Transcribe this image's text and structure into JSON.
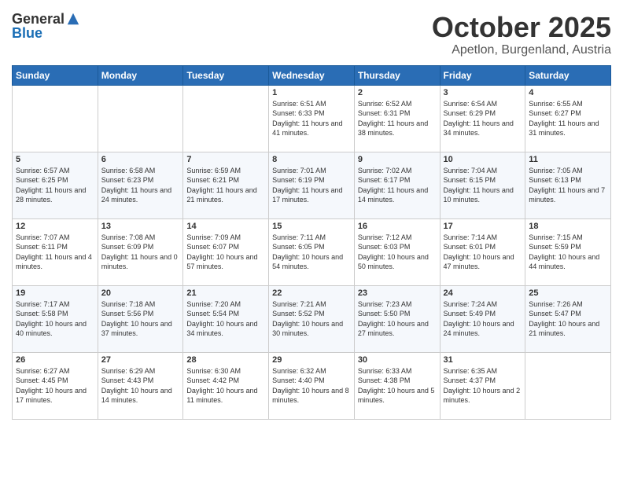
{
  "logo": {
    "general": "General",
    "blue": "Blue"
  },
  "header": {
    "month": "October 2025",
    "location": "Apetlon, Burgenland, Austria"
  },
  "days_of_week": [
    "Sunday",
    "Monday",
    "Tuesday",
    "Wednesday",
    "Thursday",
    "Friday",
    "Saturday"
  ],
  "weeks": [
    [
      {
        "day": "",
        "info": ""
      },
      {
        "day": "",
        "info": ""
      },
      {
        "day": "",
        "info": ""
      },
      {
        "day": "1",
        "info": "Sunrise: 6:51 AM\nSunset: 6:33 PM\nDaylight: 11 hours and 41 minutes."
      },
      {
        "day": "2",
        "info": "Sunrise: 6:52 AM\nSunset: 6:31 PM\nDaylight: 11 hours and 38 minutes."
      },
      {
        "day": "3",
        "info": "Sunrise: 6:54 AM\nSunset: 6:29 PM\nDaylight: 11 hours and 34 minutes."
      },
      {
        "day": "4",
        "info": "Sunrise: 6:55 AM\nSunset: 6:27 PM\nDaylight: 11 hours and 31 minutes."
      }
    ],
    [
      {
        "day": "5",
        "info": "Sunrise: 6:57 AM\nSunset: 6:25 PM\nDaylight: 11 hours and 28 minutes."
      },
      {
        "day": "6",
        "info": "Sunrise: 6:58 AM\nSunset: 6:23 PM\nDaylight: 11 hours and 24 minutes."
      },
      {
        "day": "7",
        "info": "Sunrise: 6:59 AM\nSunset: 6:21 PM\nDaylight: 11 hours and 21 minutes."
      },
      {
        "day": "8",
        "info": "Sunrise: 7:01 AM\nSunset: 6:19 PM\nDaylight: 11 hours and 17 minutes."
      },
      {
        "day": "9",
        "info": "Sunrise: 7:02 AM\nSunset: 6:17 PM\nDaylight: 11 hours and 14 minutes."
      },
      {
        "day": "10",
        "info": "Sunrise: 7:04 AM\nSunset: 6:15 PM\nDaylight: 11 hours and 10 minutes."
      },
      {
        "day": "11",
        "info": "Sunrise: 7:05 AM\nSunset: 6:13 PM\nDaylight: 11 hours and 7 minutes."
      }
    ],
    [
      {
        "day": "12",
        "info": "Sunrise: 7:07 AM\nSunset: 6:11 PM\nDaylight: 11 hours and 4 minutes."
      },
      {
        "day": "13",
        "info": "Sunrise: 7:08 AM\nSunset: 6:09 PM\nDaylight: 11 hours and 0 minutes."
      },
      {
        "day": "14",
        "info": "Sunrise: 7:09 AM\nSunset: 6:07 PM\nDaylight: 10 hours and 57 minutes."
      },
      {
        "day": "15",
        "info": "Sunrise: 7:11 AM\nSunset: 6:05 PM\nDaylight: 10 hours and 54 minutes."
      },
      {
        "day": "16",
        "info": "Sunrise: 7:12 AM\nSunset: 6:03 PM\nDaylight: 10 hours and 50 minutes."
      },
      {
        "day": "17",
        "info": "Sunrise: 7:14 AM\nSunset: 6:01 PM\nDaylight: 10 hours and 47 minutes."
      },
      {
        "day": "18",
        "info": "Sunrise: 7:15 AM\nSunset: 5:59 PM\nDaylight: 10 hours and 44 minutes."
      }
    ],
    [
      {
        "day": "19",
        "info": "Sunrise: 7:17 AM\nSunset: 5:58 PM\nDaylight: 10 hours and 40 minutes."
      },
      {
        "day": "20",
        "info": "Sunrise: 7:18 AM\nSunset: 5:56 PM\nDaylight: 10 hours and 37 minutes."
      },
      {
        "day": "21",
        "info": "Sunrise: 7:20 AM\nSunset: 5:54 PM\nDaylight: 10 hours and 34 minutes."
      },
      {
        "day": "22",
        "info": "Sunrise: 7:21 AM\nSunset: 5:52 PM\nDaylight: 10 hours and 30 minutes."
      },
      {
        "day": "23",
        "info": "Sunrise: 7:23 AM\nSunset: 5:50 PM\nDaylight: 10 hours and 27 minutes."
      },
      {
        "day": "24",
        "info": "Sunrise: 7:24 AM\nSunset: 5:49 PM\nDaylight: 10 hours and 24 minutes."
      },
      {
        "day": "25",
        "info": "Sunrise: 7:26 AM\nSunset: 5:47 PM\nDaylight: 10 hours and 21 minutes."
      }
    ],
    [
      {
        "day": "26",
        "info": "Sunrise: 6:27 AM\nSunset: 4:45 PM\nDaylight: 10 hours and 17 minutes."
      },
      {
        "day": "27",
        "info": "Sunrise: 6:29 AM\nSunset: 4:43 PM\nDaylight: 10 hours and 14 minutes."
      },
      {
        "day": "28",
        "info": "Sunrise: 6:30 AM\nSunset: 4:42 PM\nDaylight: 10 hours and 11 minutes."
      },
      {
        "day": "29",
        "info": "Sunrise: 6:32 AM\nSunset: 4:40 PM\nDaylight: 10 hours and 8 minutes."
      },
      {
        "day": "30",
        "info": "Sunrise: 6:33 AM\nSunset: 4:38 PM\nDaylight: 10 hours and 5 minutes."
      },
      {
        "day": "31",
        "info": "Sunrise: 6:35 AM\nSunset: 4:37 PM\nDaylight: 10 hours and 2 minutes."
      },
      {
        "day": "",
        "info": ""
      }
    ]
  ]
}
